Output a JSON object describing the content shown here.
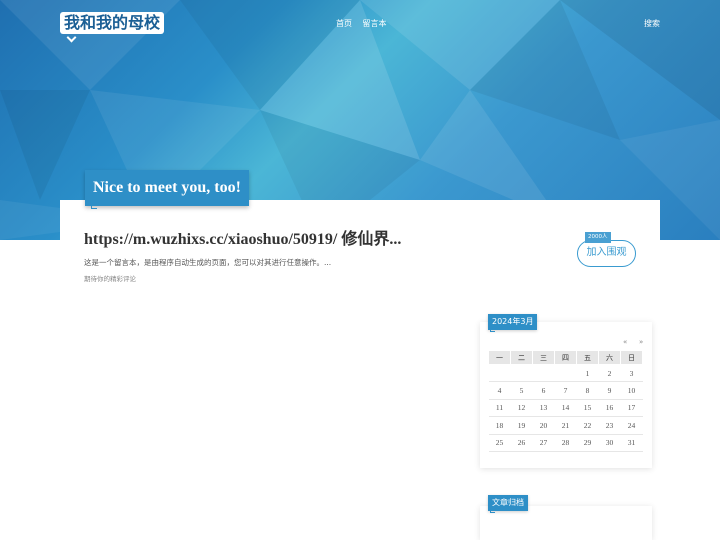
{
  "header": {
    "logo": "我和我的母校",
    "nav": [
      "首页",
      "留言本"
    ],
    "search": "搜索"
  },
  "banner": {
    "text": "Nice to meet you, too!"
  },
  "post": {
    "title": "https://m.wuzhixs.cc/xiaoshuo/50919/ 修仙界...",
    "description": "这是一个留言本，是由程序自动生成的页面，您可以对其进行任意操作。...",
    "comments_hint": "期待你的精彩评论"
  },
  "join": {
    "badge": "2000人",
    "button": "加入围观"
  },
  "calendar": {
    "title": "2024年3月",
    "prev": "«",
    "next": "»",
    "weekdays": [
      "一",
      "二",
      "三",
      "四",
      "五",
      "六",
      "日"
    ],
    "weeks": [
      [
        "",
        "",
        "",
        "",
        "1",
        "2",
        "3"
      ],
      [
        "4",
        "5",
        "6",
        "7",
        "8",
        "9",
        "10"
      ],
      [
        "11",
        "12",
        "13",
        "14",
        "15",
        "16",
        "17"
      ],
      [
        "18",
        "19",
        "20",
        "21",
        "22",
        "23",
        "24"
      ],
      [
        "25",
        "26",
        "27",
        "28",
        "29",
        "30",
        "31"
      ]
    ]
  },
  "archive": {
    "title": "文章归档"
  },
  "colors": {
    "accent": "#2e8fc7",
    "hero": "#2a8fc9"
  }
}
